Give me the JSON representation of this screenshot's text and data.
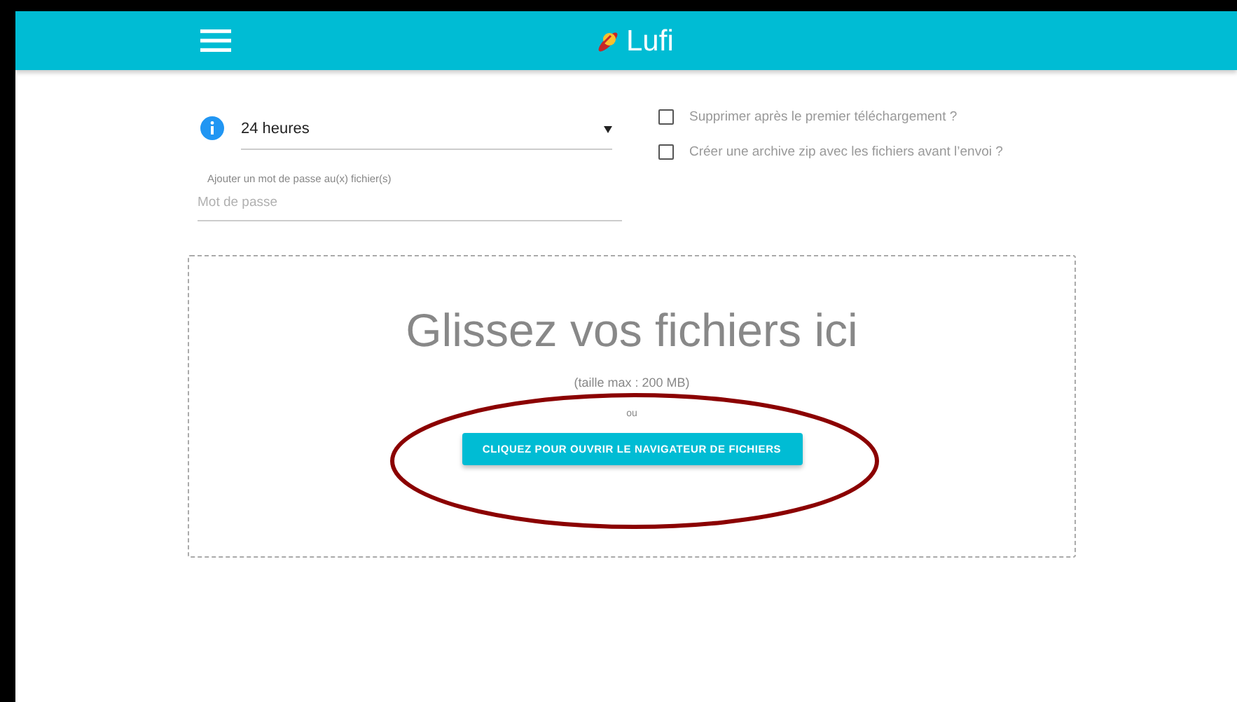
{
  "header": {
    "title": "Lufi"
  },
  "form": {
    "delay": {
      "value": "24 heures"
    },
    "password": {
      "label": "Ajouter un mot de passe au(x) fichier(s)",
      "placeholder": "Mot de passe"
    },
    "options": [
      {
        "label": "Supprimer après le premier téléchargement ?",
        "checked": false
      },
      {
        "label": "Créer une archive zip avec les fichiers avant l’envoi ?",
        "checked": false
      }
    ]
  },
  "dropzone": {
    "title": "Glissez vos fichiers ici",
    "limit": "(taille max : 200 MB)",
    "separator": "ou",
    "button": "CLIQUEZ POUR OUVRIR LE NAVIGATEUR DE FICHIERS"
  }
}
